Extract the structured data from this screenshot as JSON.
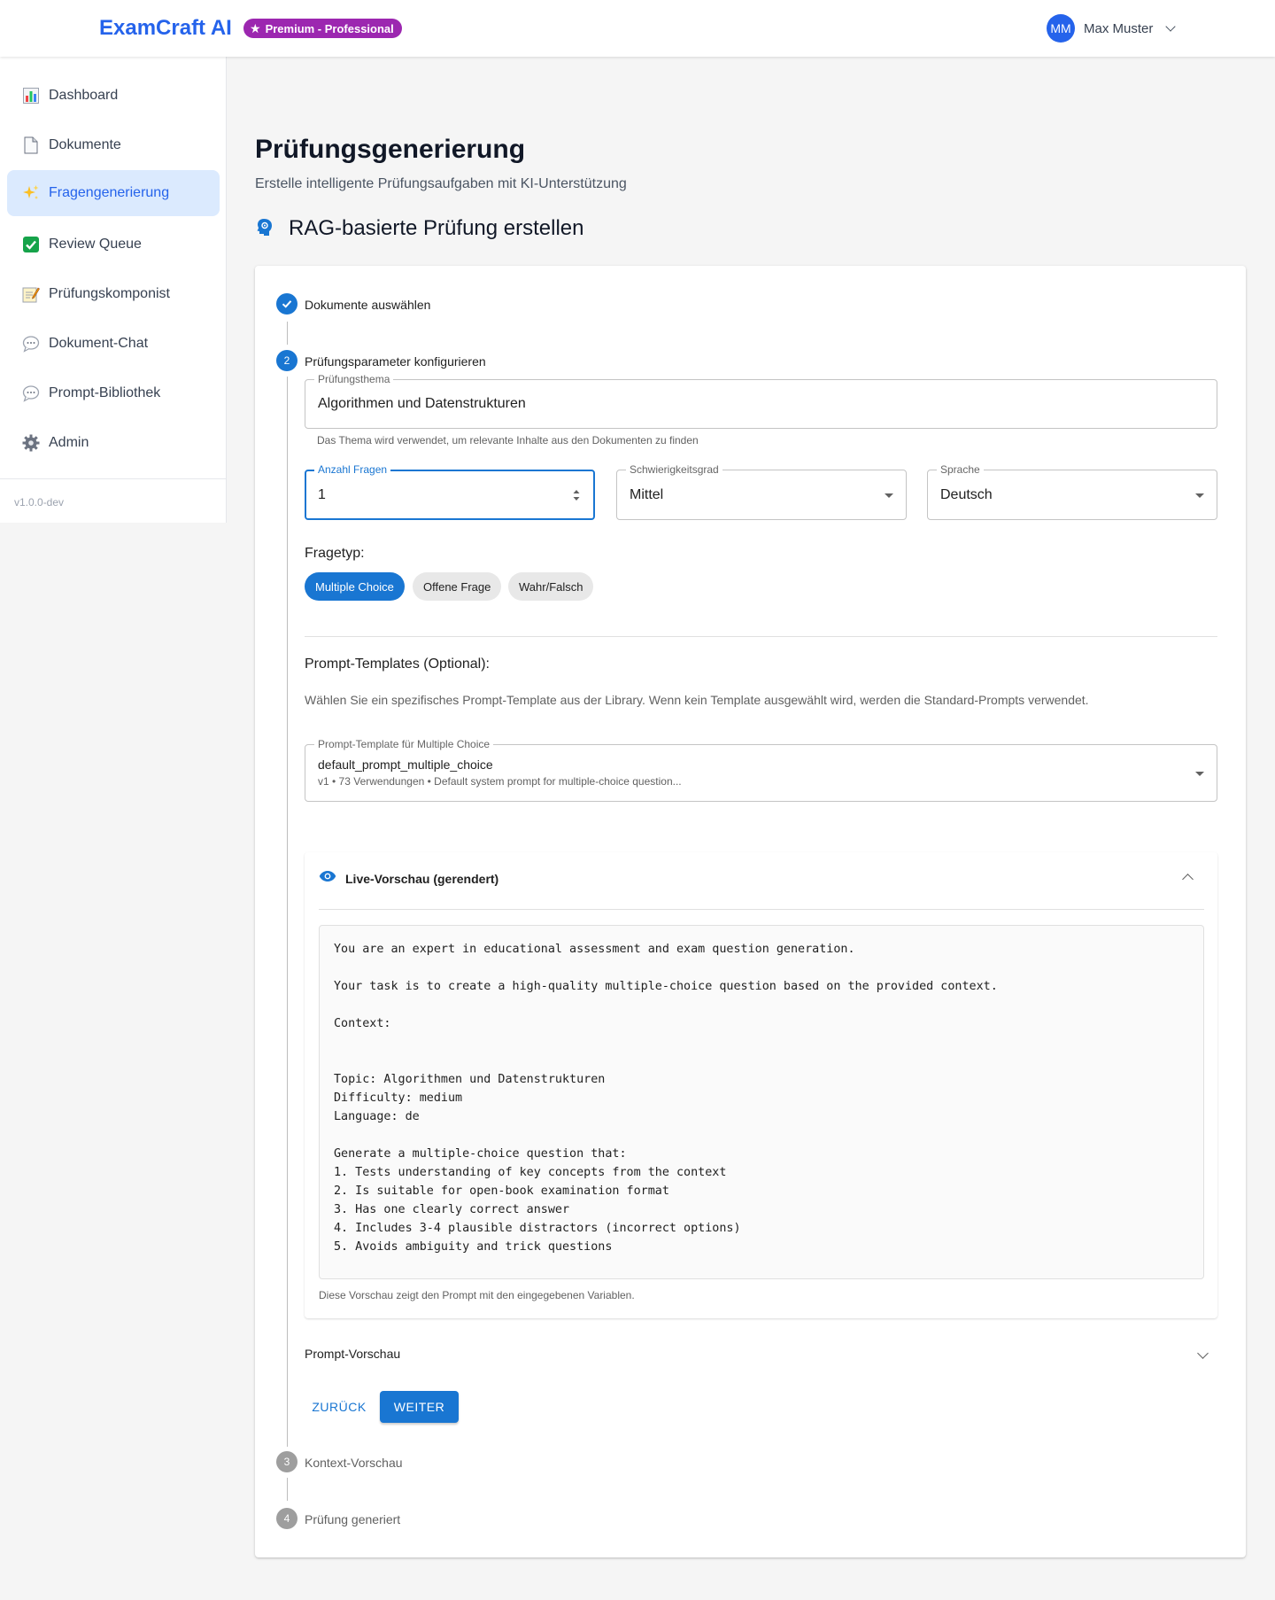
{
  "header": {
    "brand": "ExamCraft AI",
    "badge": "Premium - Professional",
    "user_initials": "MM",
    "user_name": "Max Muster"
  },
  "sidebar": {
    "items": [
      {
        "label": "Dashboard",
        "icon": "bar-chart-icon"
      },
      {
        "label": "Dokumente",
        "icon": "document-icon"
      },
      {
        "label": "Fragengenerierung",
        "icon": "sparkles-icon",
        "active": true
      },
      {
        "label": "Review Queue",
        "icon": "check-box-icon"
      },
      {
        "label": "Prüfungskomponist",
        "icon": "memo-icon"
      },
      {
        "label": "Dokument-Chat",
        "icon": "speech-bubble-icon"
      },
      {
        "label": "Prompt-Bibliothek",
        "icon": "speech-bubble-icon"
      },
      {
        "label": "Admin",
        "icon": "gear-icon"
      }
    ],
    "version": "v1.0.0-dev"
  },
  "main": {
    "title": "Prüfungsgenerierung",
    "subtitle": "Erstelle intelligente Prüfungsaufgaben mit KI-Unterstützung",
    "section_title": "RAG-basierte Prüfung erstellen"
  },
  "stepper": {
    "steps": [
      {
        "number": "1",
        "label": "Dokumente auswählen",
        "state": "done"
      },
      {
        "number": "2",
        "label": "Prüfungsparameter konfigurieren",
        "state": "active"
      },
      {
        "number": "3",
        "label": "Kontext-Vorschau",
        "state": "pending"
      },
      {
        "number": "4",
        "label": "Prüfung generiert",
        "state": "pending"
      }
    ]
  },
  "form": {
    "topic_label": "Prüfungsthema",
    "topic_value": "Algorithmen und Datenstrukturen",
    "topic_helper": "Das Thema wird verwendet, um relevante Inhalte aus den Dokumenten zu finden",
    "count_label": "Anzahl Fragen",
    "count_value": "1",
    "difficulty_label": "Schwierigkeitsgrad",
    "difficulty_value": "Mittel",
    "language_label": "Sprache",
    "language_value": "Deutsch",
    "question_type_label": "Fragetyp:",
    "question_types": [
      "Multiple Choice",
      "Offene Frage",
      "Wahr/Falsch"
    ],
    "selected_type": "Multiple Choice",
    "templates_title": "Prompt-Templates (Optional):",
    "templates_desc": "Wählen Sie ein spezifisches Prompt-Template aus der Library. Wenn kein Template ausgewählt wird, werden die Standard-Prompts verwendet.",
    "template_label": "Prompt-Template für Multiple Choice",
    "template_name": "default_prompt_multiple_choice",
    "template_meta": "v1 • 73 Verwendungen • Default system prompt for multiple-choice question..."
  },
  "live_preview": {
    "title": "Live-Vorschau (gerendert)",
    "text": "You are an expert in educational assessment and exam question generation.\n\nYour task is to create a high-quality multiple-choice question based on the provided context.\n\nContext:\n\n\nTopic: Algorithmen und Datenstrukturen\nDifficulty: medium\nLanguage: de\n\nGenerate a multiple-choice question that:\n1. Tests understanding of key concepts from the context\n2. Is suitable for open-book examination format\n3. Has one clearly correct answer\n4. Includes 3-4 plausible distractors (incorrect options)\n5. Avoids ambiguity and trick questions",
    "caption": "Diese Vorschau zeigt den Prompt mit den eingegebenen Variablen."
  },
  "prompt_preview_label": "Prompt-Vorschau",
  "buttons": {
    "back": "ZURÜCK",
    "next": "WEITER"
  },
  "colors": {
    "brand": "#2563eb",
    "primary": "#1976d2",
    "premium": "#9c27b0",
    "active_nav_bg": "#dbeafe"
  }
}
